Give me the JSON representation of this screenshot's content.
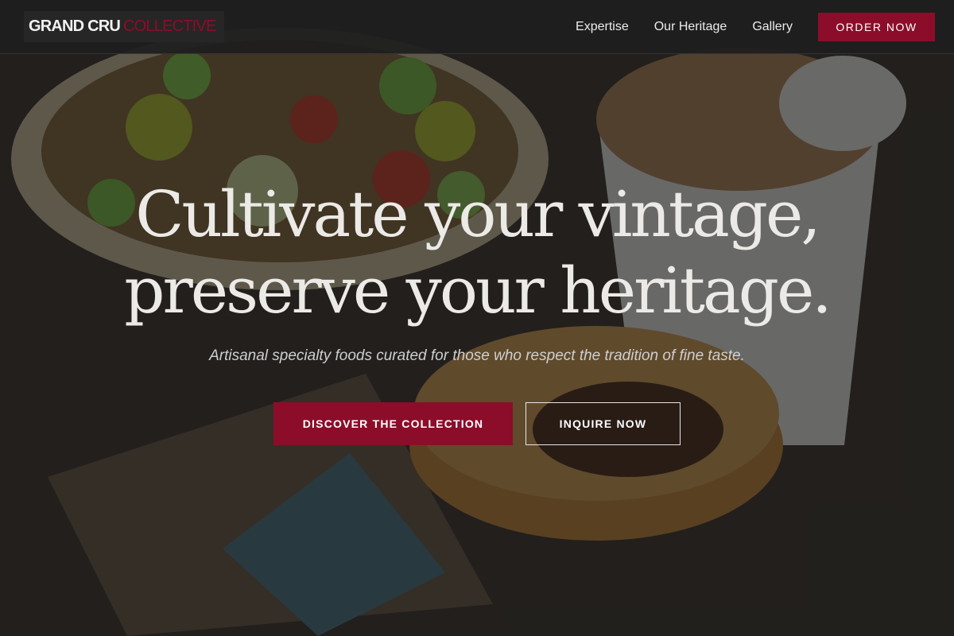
{
  "brand": {
    "main": "GRAND CRU",
    "accent": "COLLECTIVE"
  },
  "nav": {
    "links": [
      "Expertise",
      "Our Heritage",
      "Gallery"
    ],
    "cta": "ORDER NOW"
  },
  "hero": {
    "title_line1": "Cultivate your vintage,",
    "title_line2": "preserve your heritage.",
    "subtitle": "Artisanal specialty foods curated for those who respect the tradition of fine taste.",
    "primary_button": "DISCOVER THE COLLECTION",
    "secondary_button": "INQUIRE NOW",
    "background_image": "food-table-photo"
  },
  "colors": {
    "accent": "#8c0d2a",
    "navbar_bg": "#1e1e1e",
    "title_text": "#eceae6"
  }
}
